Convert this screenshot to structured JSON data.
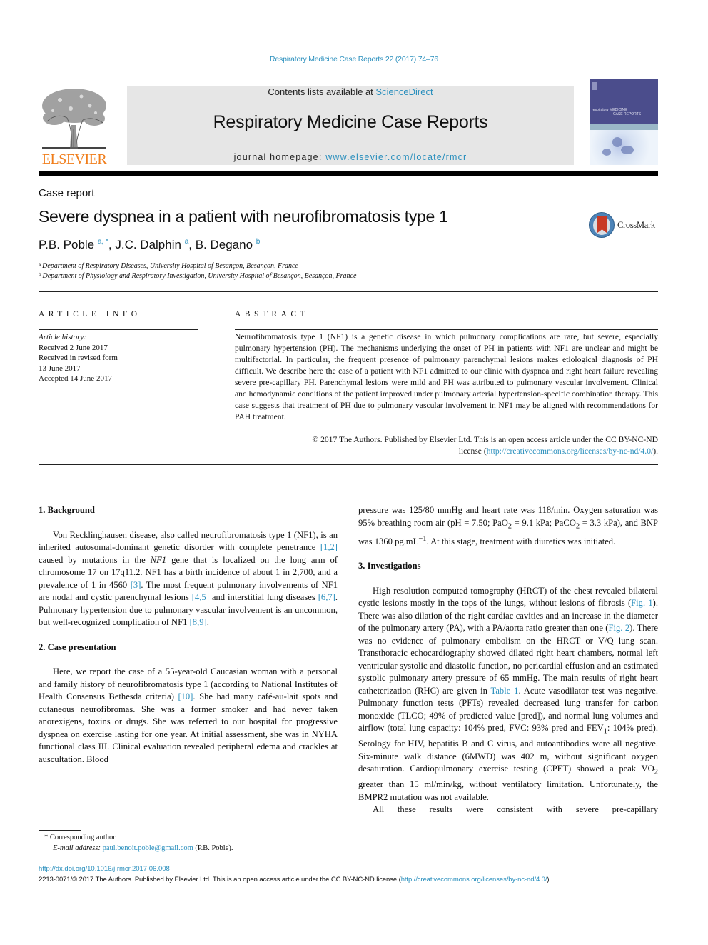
{
  "running_head": "Respiratory Medicine Case Reports 22 (2017) 74–76",
  "publisher": {
    "logo_word": "ELSEVIER",
    "logo_icon": "elsevier-tree-icon",
    "brand_color": "#f07d1a"
  },
  "masthead": {
    "contents_prefix": "Contents lists available at ",
    "contents_link": "ScienceDirect",
    "journal_title": "Respiratory Medicine Case Reports",
    "homepage_prefix": "journal homepage: ",
    "homepage_link": "www.elsevier.com/locate/rmcr",
    "cover_title_line1": "respiratory MEDICINE",
    "cover_title_line2": "CASE REPORTS"
  },
  "article": {
    "type_label": "Case report",
    "title": "Severe dyspnea in a patient with neurofibromatosis type 1",
    "authors": [
      {
        "name": "P.B. Poble",
        "marks": "a, *",
        "sep": ", "
      },
      {
        "name": "J.C. Dalphin",
        "marks": "a",
        "sep": ", "
      },
      {
        "name": "B. Degano",
        "marks": "b",
        "sep": ""
      }
    ],
    "affiliations": [
      {
        "mark": "a",
        "text": "Department of Respiratory Diseases, University Hospital of Besançon, Besançon, France"
      },
      {
        "mark": "b",
        "text": "Department of Physiology and Respiratory Investigation, University Hospital of Besançon, Besançon, France"
      }
    ],
    "crossmark_label": "CrossMark"
  },
  "article_info": {
    "heading": "ARTICLE INFO",
    "history_label": "Article history:",
    "history": [
      "Received 2 June 2017",
      "Received in revised form",
      "13 June 2017",
      "Accepted 14 June 2017"
    ]
  },
  "abstract": {
    "heading": "ABSTRACT",
    "text": "Neurofibromatosis type 1 (NF1) is a genetic disease in which pulmonary complications are rare, but severe, especially pulmonary hypertension (PH). The mechanisms underlying the onset of PH in patients with NF1 are unclear and might be multifactorial. In particular, the frequent presence of pulmonary parenchymal lesions makes etiological diagnosis of PH difficult. We describe here the case of a patient with NF1 admitted to our clinic with dyspnea and right heart failure revealing severe pre-capillary PH. Parenchymal lesions were mild and PH was attributed to pulmonary vascular involvement. Clinical and hemodynamic conditions of the patient improved under pulmonary arterial hypertension-specific combination therapy. This case suggests that treatment of PH due to pulmonary vascular involvement in NF1 may be aligned with recommendations for PAH treatment.",
    "copyright_line1": "© 2017 The Authors. Published by Elsevier Ltd. This is an open access article under the CC BY-NC-ND",
    "copyright_prefix": "license (",
    "license_link": "http://creativecommons.org/licenses/by-nc-nd/4.0/",
    "copyright_suffix": ")."
  },
  "sections": {
    "background": {
      "heading": "1.  Background",
      "p1": "Von Recklinghausen disease, also called neurofibromatosis type 1 (NF1), is an inherited autosomal-dominant genetic disorder with complete penetrance ",
      "ref1": "[1,2]",
      "p2": " caused by mutations in the ",
      "gene": "NF1",
      "p3": " gene that is localized on the long arm of chromosome 17 on 17q11.2. NF1 has a birth incidence of about 1 in 2,700, and a prevalence of 1 in 4560 ",
      "ref2": "[3]",
      "p4": ". The most frequent pulmonary involvements of NF1 are nodal and cystic parenchymal lesions ",
      "ref3": "[4,5]",
      "p5": " and interstitial lung diseases ",
      "ref4": "[6,7]",
      "p6": ". Pulmonary hypertension due to pulmonary vascular involvement is an uncommon, but well-recognized complication of NF1 ",
      "ref5": "[8,9]",
      "p7": "."
    },
    "case": {
      "heading": "2.  Case presentation",
      "p1": "Here, we report the case of a 55-year-old Caucasian woman with a personal and family history of neurofibromatosis type 1 (according to National Institutes of Health Consensus Bethesda criteria) ",
      "ref1": "[10]",
      "p2": ". She had many café-au-lait spots and cutaneous neurofibromas. She was a former smoker and had never taken anorexigens, toxins or drugs. She was referred to our hospital for progressive dyspnea on exercise lasting for one year. At initial assessment, she was in NYHA functional class III. Clinical evaluation revealed peripheral edema and crackles at auscultation. Blood",
      "cont1": "pressure was 125/80 mmHg and heart rate was 118/min. Oxygen saturation was 95% breathing room air (pH = 7.50; PaO",
      "sub1": "2",
      "cont2": " = 9.1 kPa; PaCO",
      "sub2": "2",
      "cont3": " = 3.3 kPa), and BNP was 1360 pg.mL",
      "sup1": "−1",
      "cont4": ". At this stage, treatment with diuretics was initiated."
    },
    "investigations": {
      "heading": "3.  Investigations",
      "p1": "High resolution computed tomography (HRCT) of the chest revealed bilateral cystic lesions mostly in the tops of the lungs, without lesions of fibrosis (",
      "fig1": "Fig. 1",
      "p2": "). There was also dilation of the right cardiac cavities and an increase in the diameter of the pulmonary artery (PA), with a PA/aorta ratio greater than one (",
      "fig2": "Fig. 2",
      "p3": "). There was no evidence of pulmonary embolism on the HRCT or V/Q lung scan. Transthoracic echocardiography showed dilated right heart chambers, normal left ventricular systolic and diastolic function, no pericardial effusion and an estimated systolic pulmonary artery pressure of 65 mmHg. The main results of right heart catheterization (RHC) are given in ",
      "table1": "Table 1",
      "p4": ". Acute vasodilator test was negative. Pulmonary function tests (PFTs) revealed decreased lung transfer for carbon monoxide (TLCO; 49% of predicted value [pred]), and normal lung volumes and airflow (total lung capacity: 104% pred, FVC: 93% pred and FEV",
      "sub1": "1",
      "p5": ": 104% pred). Serology for HIV, hepatitis B and C virus, and autoantibodies were all negative. Six-minute walk distance (6MWD) was 402 m, without significant oxygen desaturation. Cardiopulmonary exercise testing (CPET) showed a peak VO",
      "sub2": "2",
      "p6": " greater than 15 ml/min/kg, without ventilatory limitation. Unfortunately, the BMPR2 mutation was not available.",
      "p7": "All these results were consistent with severe pre-capillary"
    }
  },
  "footnote": {
    "corresponding": "* Corresponding author.",
    "email_label": "E-mail address: ",
    "email": "paul.benoit.poble@gmail.com",
    "email_suffix": " (P.B. Poble)."
  },
  "footer": {
    "doi": "http://dx.doi.org/10.1016/j.rmcr.2017.06.008",
    "license_prefix": "2213-0071/© 2017 The Authors. Published by Elsevier Ltd. This is an open access article under the CC BY-NC-ND license (",
    "license_link": "http://creativecommons.org/licenses/by-nc-nd/4.0/",
    "license_suffix": ")."
  },
  "colors": {
    "link": "#2a8fbd",
    "masthead_bg": "#e6e6e6",
    "crossmark_red": "#c83a25"
  }
}
